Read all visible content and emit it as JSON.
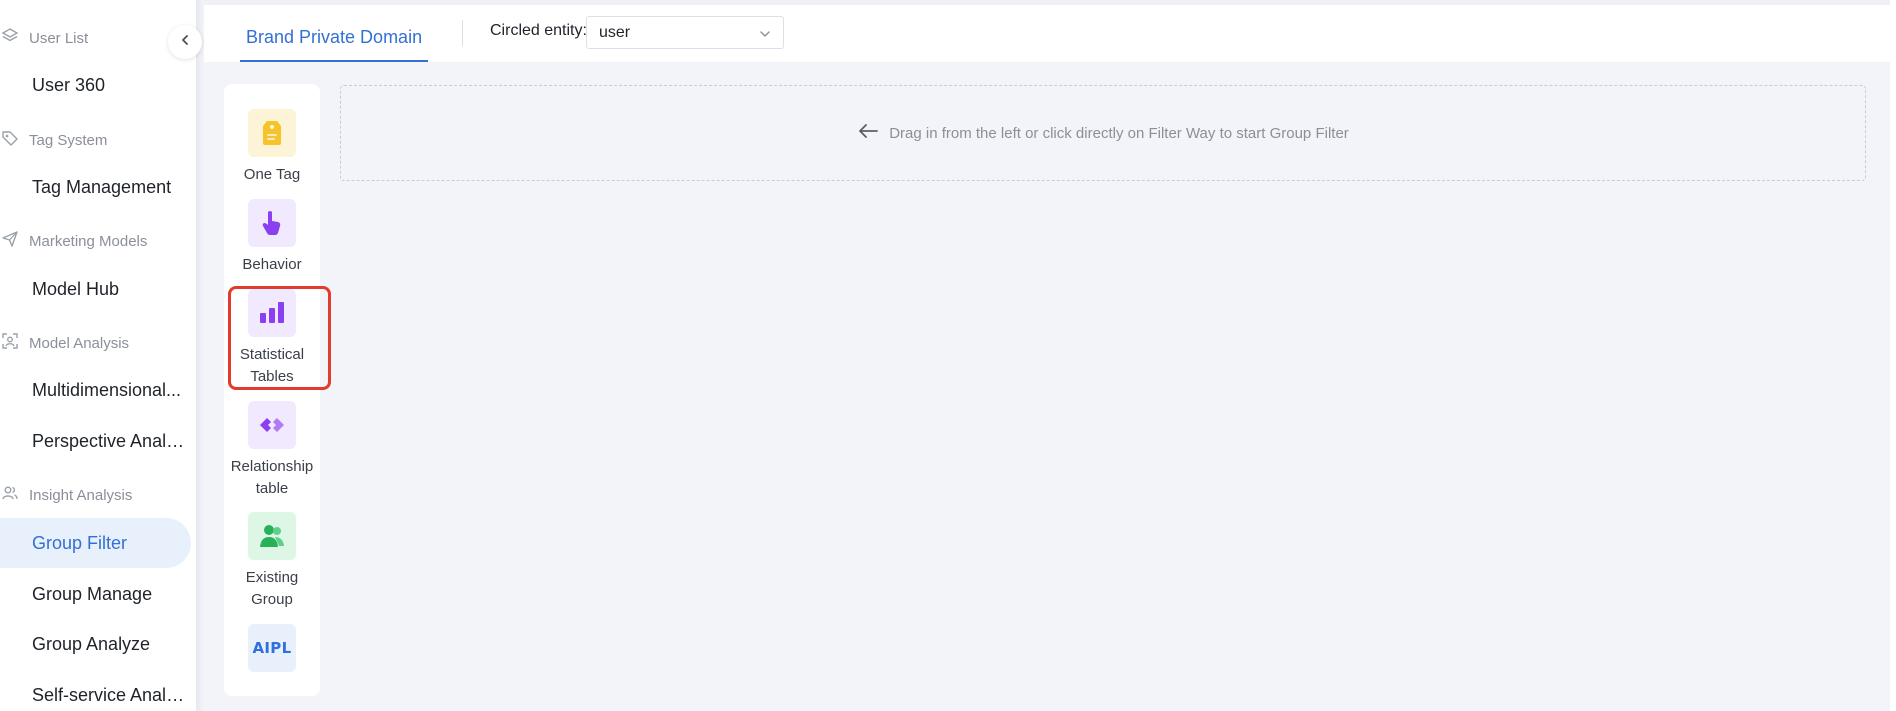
{
  "sidebar": {
    "groups": [
      {
        "label": "User List",
        "icon": "layers-icon",
        "items": [
          {
            "label": "User 360"
          }
        ]
      },
      {
        "label": "Tag System",
        "icon": "tag-icon",
        "items": [
          {
            "label": "Tag Management"
          }
        ]
      },
      {
        "label": "Marketing Models",
        "icon": "send-icon",
        "items": [
          {
            "label": "Model Hub"
          }
        ]
      },
      {
        "label": "Model Analysis",
        "icon": "scan-user-icon",
        "items": [
          {
            "label": "Multidimensional..."
          },
          {
            "label": "Perspective Analy..."
          }
        ]
      },
      {
        "label": "Insight Analysis",
        "icon": "users-icon",
        "items": [
          {
            "label": "Group Filter",
            "active": true
          },
          {
            "label": "Group Manage"
          },
          {
            "label": "Group Analyze"
          },
          {
            "label": "Self-service Analy..."
          }
        ]
      }
    ]
  },
  "header": {
    "tab_label": "Brand Private Domain",
    "entity_label": "Circled entity:",
    "entity_value": "user"
  },
  "filter_ways": [
    {
      "label": "One Tag",
      "icon": "tag-icon"
    },
    {
      "label": "Behavior",
      "icon": "pointer-hand-icon"
    },
    {
      "label": "Statistical Tables",
      "icon": "bar-chart-icon"
    },
    {
      "label": "Relationship table",
      "icon": "link-icon"
    },
    {
      "label": "Existing Group",
      "icon": "users-icon"
    },
    {
      "label": "AIPL",
      "icon": "aipl-icon"
    }
  ],
  "drop_zone": {
    "hint": "Drag in from the left or click directly on Filter Way to start Group Filter"
  },
  "colors": {
    "accent": "#3370d4",
    "highlight": "#e23b2e",
    "active_bg": "#e8f0fc"
  }
}
